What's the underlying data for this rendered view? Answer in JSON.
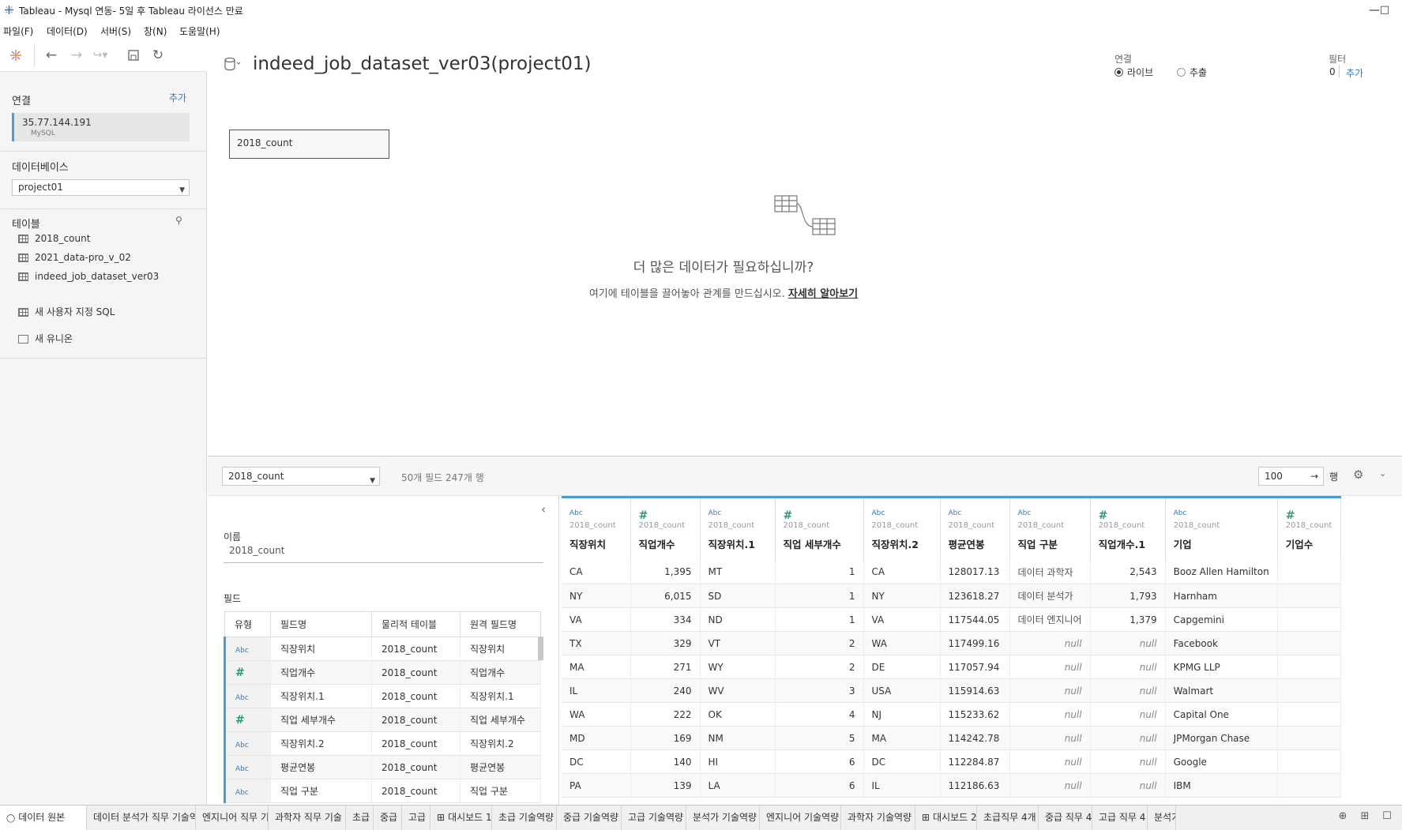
{
  "window": {
    "title": "Tableau - Mysql 연동- 5일 후 Tableau 라이선스 만료"
  },
  "menu": [
    "파일(F)",
    "데이터(D)",
    "서버(S)",
    "창(N)",
    "도움말(H)"
  ],
  "sidebar": {
    "connection_title": "연결",
    "connection_add": "추가",
    "connection_host": "35.77.144.191",
    "connection_type": "MySQL",
    "database_title": "데이터베이스",
    "database_value": "project01",
    "tables_title": "테이블",
    "tables": [
      "2018_count",
      "2021_data-pro_v_02",
      "indeed_job_dataset_ver03"
    ],
    "custom_sql": "새 사용자 지정 SQL",
    "new_union": "새 유니온"
  },
  "canvas": {
    "datasource_name": "indeed_job_dataset_ver03(project01)",
    "connection_label": "연결",
    "live_label": "라이브",
    "extract_label": "추출",
    "filter_label": "필터",
    "filter_count": "0",
    "filter_add": "추가",
    "table_card": "2018_count",
    "more_data_title": "더 많은 데이터가 필요하십니까?",
    "more_data_desc": "여기에 테이블을 끌어놓아 관계를 만드십시오.",
    "learn_more": "자세히 알아보기"
  },
  "lower_toolbar": {
    "table_select": "2018_count",
    "summary": "50개 필드 247개 행",
    "rows_value": "100",
    "rows_label": "행"
  },
  "meta_panel": {
    "name_label": "이름",
    "name_value": "2018_count",
    "fields_label": "필드",
    "headers": [
      "유형",
      "필드명",
      "물리적 테이블",
      "원격 필드명"
    ],
    "rows": [
      {
        "type": "Abc",
        "field": "직장위치",
        "table": "2018_count",
        "remote": "직장위치"
      },
      {
        "type": "#",
        "field": "직업개수",
        "table": "2018_count",
        "remote": "직업개수"
      },
      {
        "type": "Abc",
        "field": "직장위치.1",
        "table": "2018_count",
        "remote": "직장위치.1"
      },
      {
        "type": "#",
        "field": "직업 세부개수",
        "table": "2018_count",
        "remote": "직업 세부개수"
      },
      {
        "type": "Abc",
        "field": "직장위치.2",
        "table": "2018_count",
        "remote": "직장위치.2"
      },
      {
        "type": "Abc",
        "field": "평균연봉",
        "table": "2018_count",
        "remote": "평균연봉"
      },
      {
        "type": "Abc",
        "field": "직업 구분",
        "table": "2018_count",
        "remote": "직업 구분"
      }
    ]
  },
  "grid": {
    "source": "2018_count",
    "columns": [
      {
        "type": "Abc",
        "name": "직장위치",
        "align": "left"
      },
      {
        "type": "#",
        "name": "직업개수",
        "align": "num"
      },
      {
        "type": "Abc",
        "name": "직장위치.1",
        "align": "left"
      },
      {
        "type": "#",
        "name": "직업 세부개수",
        "align": "num"
      },
      {
        "type": "Abc",
        "name": "직장위치.2",
        "align": "left"
      },
      {
        "type": "Abc",
        "name": "평균연봉",
        "align": "left"
      },
      {
        "type": "Abc",
        "name": "직업 구분",
        "align": "kor"
      },
      {
        "type": "#",
        "name": "직업개수.1",
        "align": "num"
      },
      {
        "type": "Abc",
        "name": "기업",
        "align": "left"
      },
      {
        "type": "#",
        "name": "기업수",
        "align": "num"
      }
    ],
    "rows": [
      [
        "CA",
        "1,395",
        "MT",
        "1",
        "CA",
        "128017.13",
        "데이터 과학자",
        "2,543",
        "Booz Allen Hamilton",
        ""
      ],
      [
        "NY",
        "6,015",
        "SD",
        "1",
        "NY",
        "123618.27",
        "데이터 분석가",
        "1,793",
        "Harnham",
        ""
      ],
      [
        "VA",
        "334",
        "ND",
        "1",
        "VA",
        "117544.05",
        "데이터 엔지니어",
        "1,379",
        "Capgemini",
        ""
      ],
      [
        "TX",
        "329",
        "VT",
        "2",
        "WA",
        "117499.16",
        "null",
        "null",
        "Facebook",
        ""
      ],
      [
        "MA",
        "271",
        "WY",
        "2",
        "DE",
        "117057.94",
        "null",
        "null",
        "KPMG LLP",
        ""
      ],
      [
        "IL",
        "240",
        "WV",
        "3",
        "USA",
        "115914.63",
        "null",
        "null",
        "Walmart",
        ""
      ],
      [
        "WA",
        "222",
        "OK",
        "4",
        "NJ",
        "115233.62",
        "null",
        "null",
        "Capital One",
        ""
      ],
      [
        "MD",
        "169",
        "NM",
        "5",
        "MA",
        "114242.78",
        "null",
        "null",
        "JPMorgan Chase",
        ""
      ],
      [
        "DC",
        "140",
        "HI",
        "6",
        "DC",
        "112284.87",
        "null",
        "null",
        "Google",
        ""
      ],
      [
        "PA",
        "139",
        "LA",
        "6",
        "IL",
        "112186.63",
        "null",
        "null",
        "IBM",
        ""
      ]
    ]
  },
  "tabs": [
    "데이터 원본",
    "데이터 분석가 직무 기술역",
    "엔지니어 직무 기",
    "과학자 직무 기술",
    "초급",
    "중급",
    "고급",
    "대시보드 1",
    "초급 기술역량",
    "중급 기술역량",
    "고급 기술역량",
    "분석가 기술역량",
    "엔지니어 기술역량",
    "과학자 기술역량",
    "대시보드 2",
    "초급직무 4개",
    "중급 직무 4",
    "고급 직무 4",
    "분석가"
  ]
}
